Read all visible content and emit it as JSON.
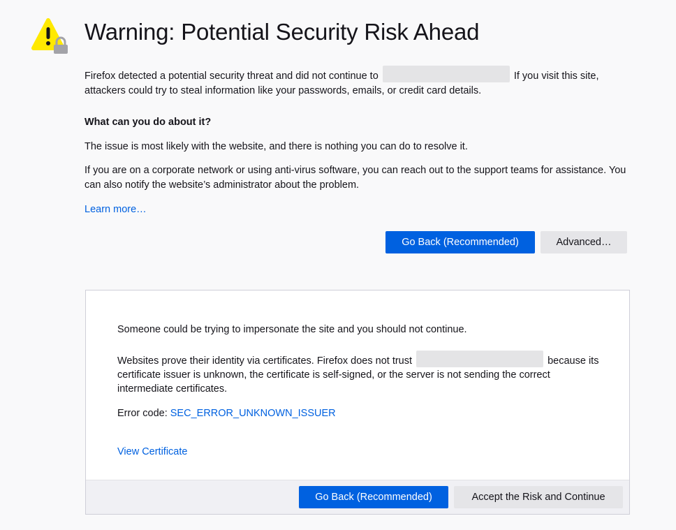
{
  "page": {
    "title": "Warning: Potential Security Risk Ahead",
    "intro_before": "Firefox detected a potential security threat and did not continue to",
    "intro_after": "If you visit this site, attackers could try to steal information like your passwords, emails, or credit card details.",
    "what_heading": "What can you do about it?",
    "issue_text": "The issue is most likely with the website, and there is nothing you can do to resolve it.",
    "corporate_text": "If you are on a corporate network or using anti-virus software, you can reach out to the support teams for assistance. You can also notify the website’s administrator about the problem.",
    "learn_more": "Learn more…",
    "go_back_label": "Go Back (Recommended)",
    "advanced_label": "Advanced…"
  },
  "advanced_panel": {
    "impersonate_text": "Someone could be trying to impersonate the site and you should not continue.",
    "cert_before": "Websites prove their identity via certificates. Firefox does not trust",
    "cert_after": "because its certificate issuer is unknown, the certificate is self-signed, or the server is not sending the correct intermediate certificates.",
    "error_code_label": "Error code:",
    "error_code": "SEC_ERROR_UNKNOWN_ISSUER",
    "view_certificate": "View Certificate",
    "go_back_label": "Go Back (Recommended)",
    "accept_label": "Accept the Risk and Continue"
  },
  "colors": {
    "background": "#f9f9fa",
    "primary_button": "#0061e0",
    "link": "#0061e0",
    "warning_yellow": "#ffe900",
    "redaction": "#e4e4e6"
  },
  "icons": {
    "warning": "warning-lock-icon"
  }
}
